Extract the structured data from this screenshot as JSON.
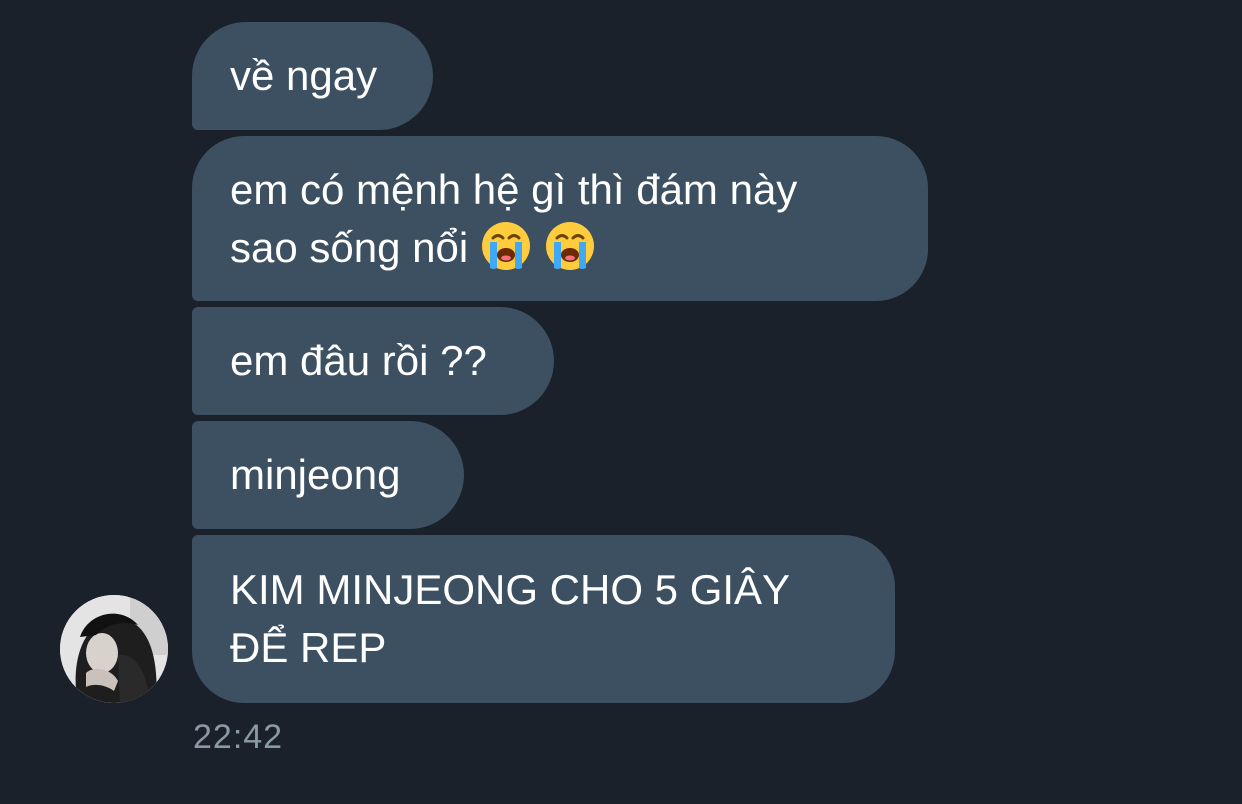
{
  "messages": [
    {
      "text": "về ngay"
    },
    {
      "text": "em có mệnh hệ gì thì đám này\nsao sống nổi",
      "emojis": [
        "loudly-crying-face",
        "loudly-crying-face"
      ]
    },
    {
      "text": "em đâu rồi ??"
    },
    {
      "text": "minjeong"
    },
    {
      "text": "KIM MINJEONG CHO 5 GIÂY\nĐỂ REP"
    }
  ],
  "timestamp": "22:42",
  "colors": {
    "background": "#1a212b",
    "bubble": "#3d5061",
    "text": "#ffffff",
    "timestamp": "#8b98a5"
  },
  "avatar": {
    "icon": "profile-photo"
  }
}
